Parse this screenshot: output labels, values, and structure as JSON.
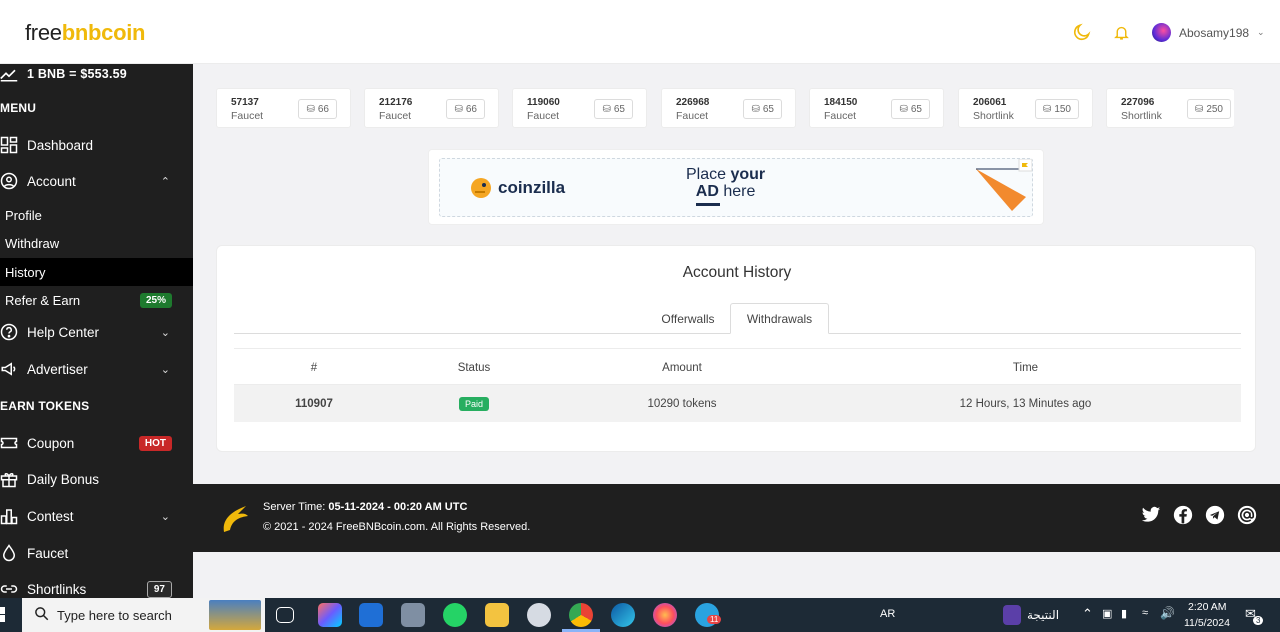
{
  "header": {
    "logo_part1": "free",
    "logo_part2": "bnbcoin",
    "username": "Abosamy198"
  },
  "sidebar": {
    "price": "1 BNB = $553.59",
    "menu_heading": "MENU",
    "earn_heading": "EARN TOKENS",
    "items": {
      "dashboard": "Dashboard",
      "account": "Account",
      "profile": "Profile",
      "withdraw": "Withdraw",
      "history": "History",
      "refer": "Refer & Earn",
      "refer_badge": "25%",
      "help": "Help Center",
      "advertiser": "Advertiser",
      "coupon": "Coupon",
      "coupon_badge": "HOT",
      "daily_bonus": "Daily Bonus",
      "contest": "Contest",
      "faucet": "Faucet",
      "shortlinks": "Shortlinks",
      "shortlinks_badge": "97"
    }
  },
  "stats": [
    {
      "num": "57137",
      "kind": "Faucet",
      "value": "66"
    },
    {
      "num": "212176",
      "kind": "Faucet",
      "value": "66"
    },
    {
      "num": "119060",
      "kind": "Faucet",
      "value": "65"
    },
    {
      "num": "226968",
      "kind": "Faucet",
      "value": "65"
    },
    {
      "num": "184150",
      "kind": "Faucet",
      "value": "65"
    },
    {
      "num": "206061",
      "kind": "Shortlink",
      "value": "150"
    },
    {
      "num": "227096",
      "kind": "Shortlink",
      "value": "250"
    }
  ],
  "ad": {
    "brand": "coinzilla",
    "line1_a": "Place ",
    "line1_b": "your",
    "line2_a": "AD",
    "line2_b": " here"
  },
  "history": {
    "title": "Account History",
    "tabs": [
      "Offerwalls",
      "Withdrawals"
    ],
    "columns": [
      "#",
      "Status",
      "Amount",
      "Time"
    ],
    "rows": [
      {
        "id": "110907",
        "status": "Paid",
        "amount": "10290 tokens",
        "time": "12 Hours, 13 Minutes ago"
      }
    ]
  },
  "footer": {
    "server_label": "Server Time: ",
    "server_time": "05-11-2024 - 00:20 AM UTC",
    "copyright": "© 2021 - 2024 FreeBNBcoin.com. All Rights Reserved."
  },
  "taskbar": {
    "search_placeholder": "Type here to search",
    "lang": "AR",
    "weather": "النتيجة",
    "time": "2:20 AM",
    "date": "11/5/2024",
    "notif_count": "3",
    "telegram_badge": "11"
  },
  "colors": {
    "accent": "#f0b90b",
    "sidebar_bg": "#1f1f1f",
    "paid_green": "#27ae60",
    "hot_red": "#c82828"
  }
}
